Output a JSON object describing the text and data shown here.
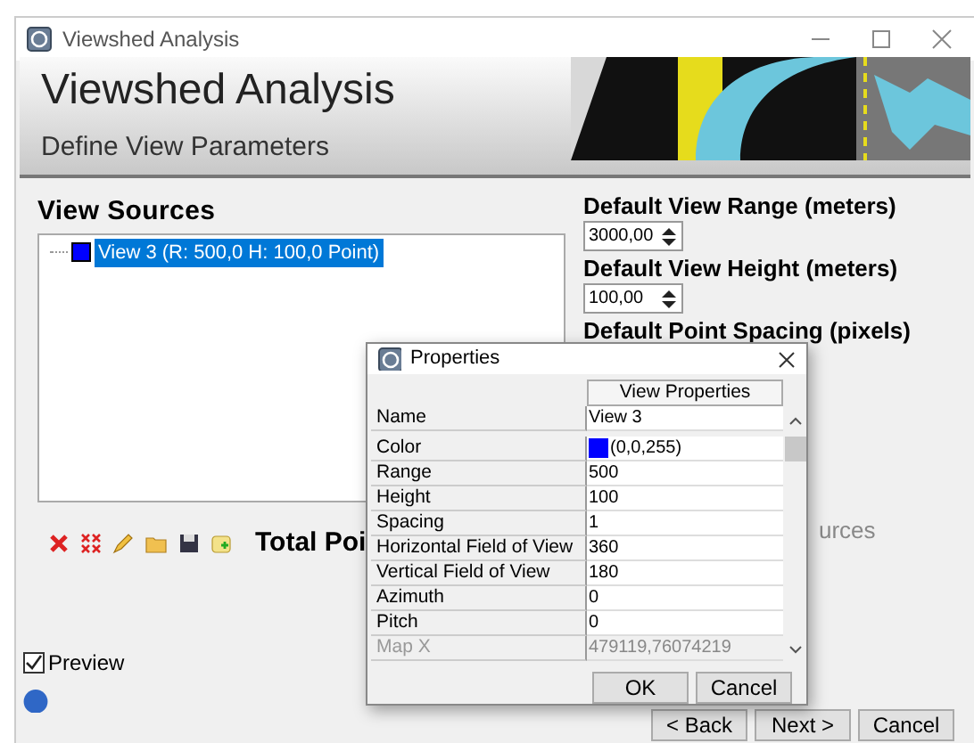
{
  "window": {
    "title": "Viewshed Analysis"
  },
  "header": {
    "title": "Viewshed Analysis",
    "subtitle": "Define View Parameters"
  },
  "view_sources": {
    "label": "View Sources",
    "items": [
      {
        "label": "View 3 (R: 500,0 H: 100,0 Point)",
        "color": "#0000ff",
        "selected": true
      }
    ]
  },
  "toolbar_label": "Total Poi",
  "settings": [
    {
      "label": "Default View Range (meters)",
      "value": "3000,00"
    },
    {
      "label": "Default View Height (meters)",
      "value": "100,00"
    },
    {
      "label": "Default Point Spacing (pixels)"
    }
  ],
  "partial_text": "urces",
  "preview": {
    "label": "Preview",
    "checked": true
  },
  "buttons": [
    "< Back",
    "Next >",
    "Cancel"
  ],
  "dialog": {
    "title": "Properties",
    "column": "View Properties",
    "rows": [
      {
        "kind": "text",
        "name": "Name",
        "value": "View 3",
        "disabled": false
      },
      {
        "kind": "color",
        "name": "Color",
        "value": "(0,0,255)",
        "color": "#0000ff",
        "disabled": false
      },
      {
        "kind": "text",
        "name": "Range",
        "value": "500",
        "disabled": false
      },
      {
        "kind": "text",
        "name": "Height",
        "value": "100",
        "disabled": false
      },
      {
        "kind": "text",
        "name": "Spacing",
        "value": "1",
        "disabled": false
      },
      {
        "kind": "text",
        "name": "Horizontal Field of View",
        "value": "360",
        "disabled": false
      },
      {
        "kind": "text",
        "name": "Vertical Field of View",
        "value": "180",
        "disabled": false
      },
      {
        "kind": "text",
        "name": "Azimuth",
        "value": "0",
        "disabled": false
      },
      {
        "kind": "text",
        "name": "Pitch",
        "value": "0",
        "disabled": false
      },
      {
        "kind": "text",
        "name": "Map X",
        "value": "479119,76074219",
        "disabled": true
      }
    ],
    "buttons": [
      "OK",
      "Cancel"
    ]
  }
}
